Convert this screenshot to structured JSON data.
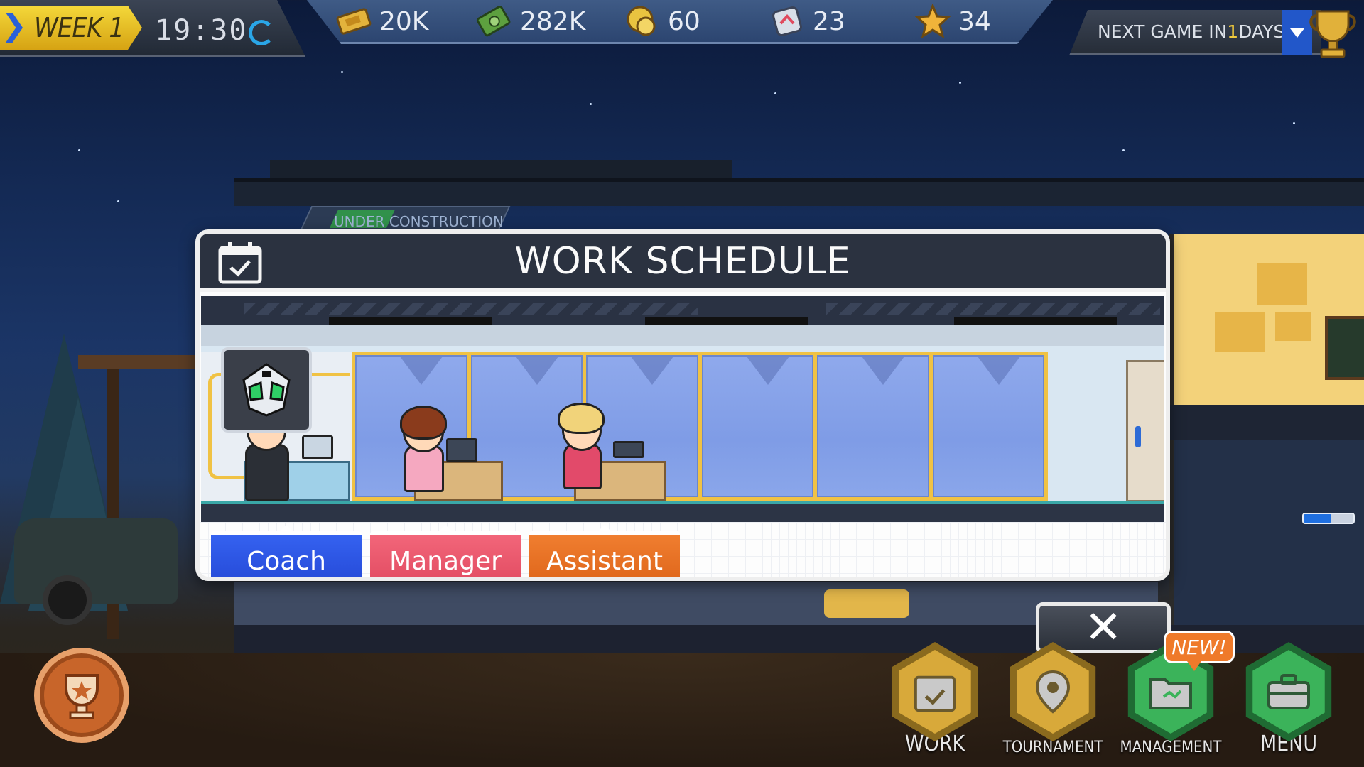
{
  "hud": {
    "week_label": "WEEK 1",
    "clock": "19:30",
    "resources": [
      {
        "icon": "ticket-icon",
        "value": "20K"
      },
      {
        "icon": "cash-icon",
        "value": "282K"
      },
      {
        "icon": "coin-icon",
        "value": "60"
      },
      {
        "icon": "fans-icon",
        "value": "23"
      },
      {
        "icon": "star-icon",
        "value": "34"
      }
    ],
    "next_game": {
      "prefix": "NEXT GAME IN ",
      "days": "1",
      "suffix": " DAYS"
    }
  },
  "background": {
    "sign_text": "UNDER CONSTRUCTION",
    "progress_fraction": 0.55
  },
  "modal": {
    "title": "WORK SCHEDULE",
    "roles": [
      {
        "label": "Coach",
        "color": "#2f5be8"
      },
      {
        "label": "Manager",
        "color": "#ea5a6e"
      },
      {
        "label": "Assistant",
        "color": "#e8702a"
      }
    ]
  },
  "close": {
    "label": "✕"
  },
  "bottom_nav": {
    "items": [
      {
        "label": "WORK",
        "icon": "calendar-icon",
        "color": "#d8a93a"
      },
      {
        "label": "TOURNAMENT",
        "icon": "map-pin-icon",
        "color": "#d8a93a"
      },
      {
        "label": "MANAGEMENT",
        "icon": "folder-icon",
        "color": "#3bb35a"
      },
      {
        "label": "MENU",
        "icon": "briefcase-icon",
        "color": "#3bb35a"
      }
    ],
    "new_badge": "NEW!"
  }
}
